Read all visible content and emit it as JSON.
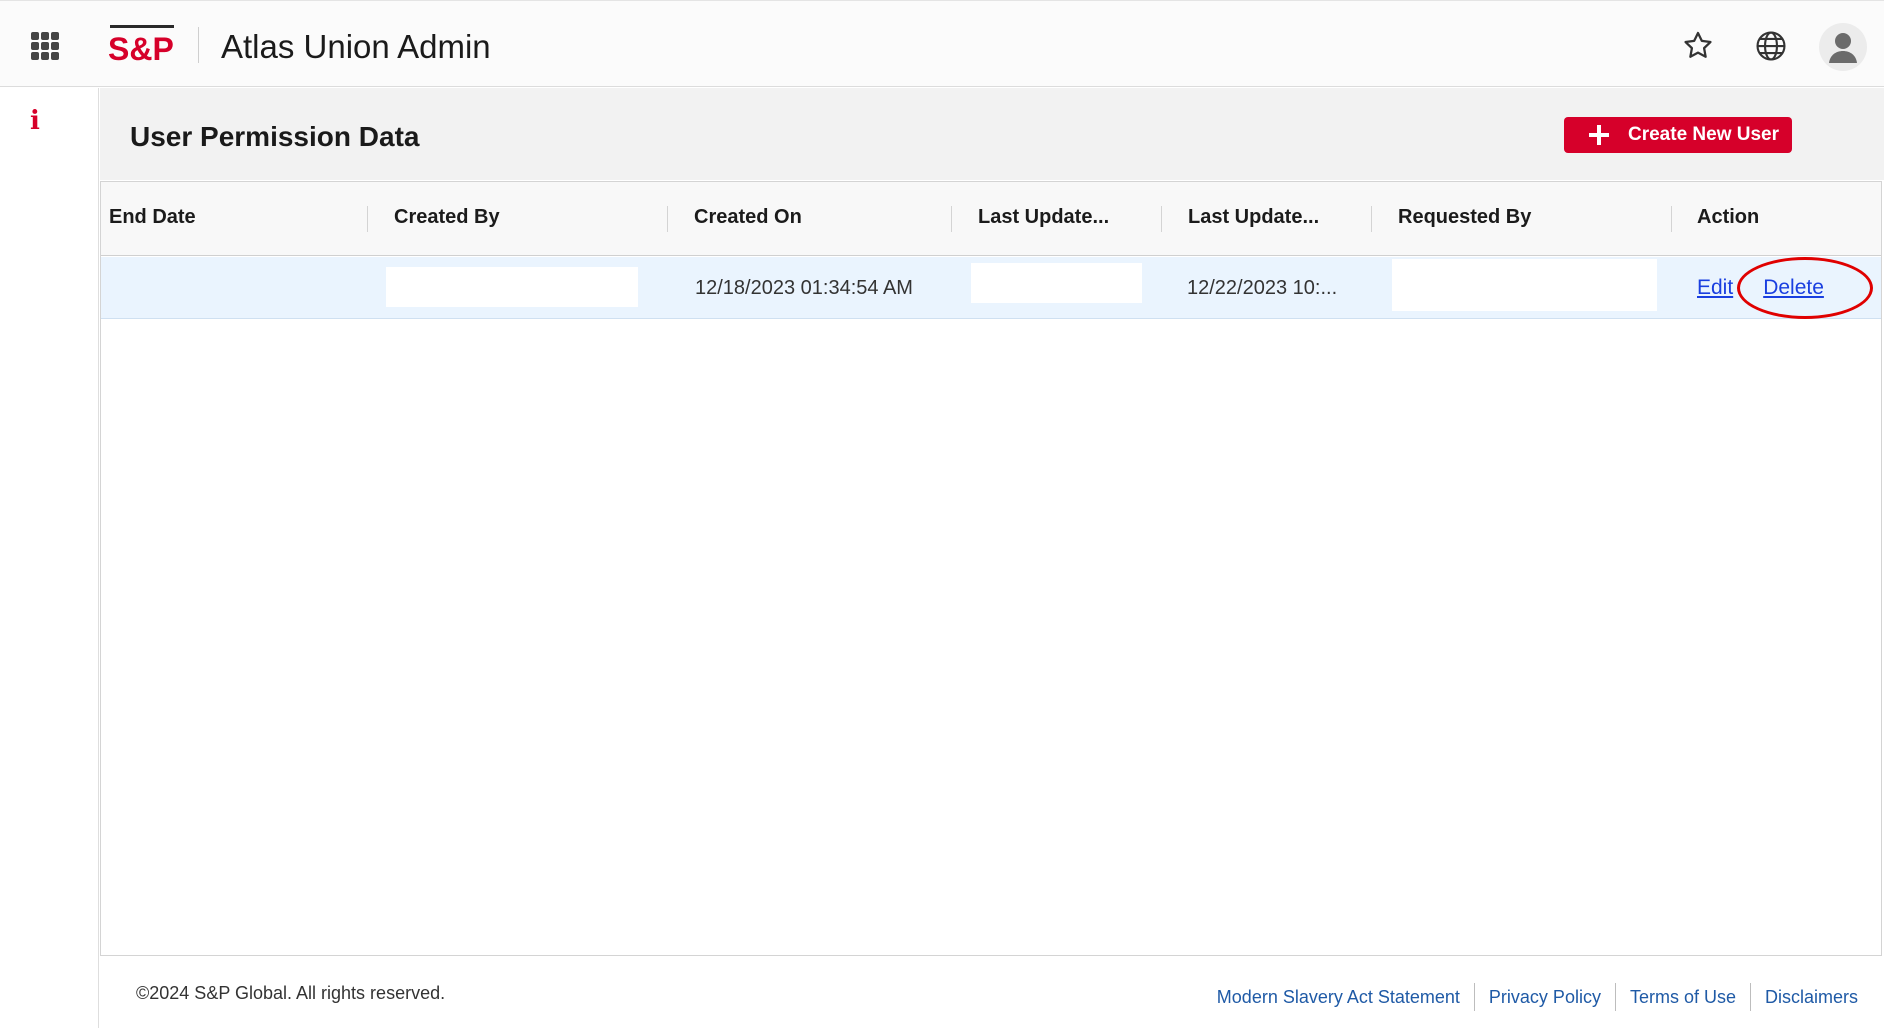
{
  "header": {
    "brand": "S&P",
    "app_title": "Atlas Union Admin",
    "icons": [
      "app-launcher-icon",
      "star-icon",
      "globe-icon",
      "user-avatar-icon"
    ]
  },
  "sidebar": {
    "info_glyph": "i"
  },
  "page": {
    "title": "User Permission Data",
    "create_button_label": "Create New User"
  },
  "grid": {
    "columns": [
      "End Date",
      "Created By",
      "Created On",
      "Last Update...",
      "Last Update...",
      "Requested By",
      "Action"
    ],
    "rows": [
      {
        "end_date": "",
        "created_by": "",
        "created_on": "12/18/2023 01:34:54 AM",
        "last_updated_by": "",
        "last_updated_on": "12/22/2023 10:...",
        "requested_by": "",
        "actions": {
          "edit": "Edit",
          "delete": "Delete"
        }
      }
    ]
  },
  "footer": {
    "copyright": "©2024 S&P Global. All rights reserved.",
    "links": [
      "Modern Slavery Act Statement",
      "Privacy Policy",
      "Terms of Use",
      "Disclaimers"
    ]
  },
  "colors": {
    "brand_red": "#d6002a",
    "link_blue": "#1a3fe0",
    "footer_link_blue": "#1f5aa6",
    "row_selected": "#eaf4fe",
    "annotation_red": "#e00000"
  }
}
